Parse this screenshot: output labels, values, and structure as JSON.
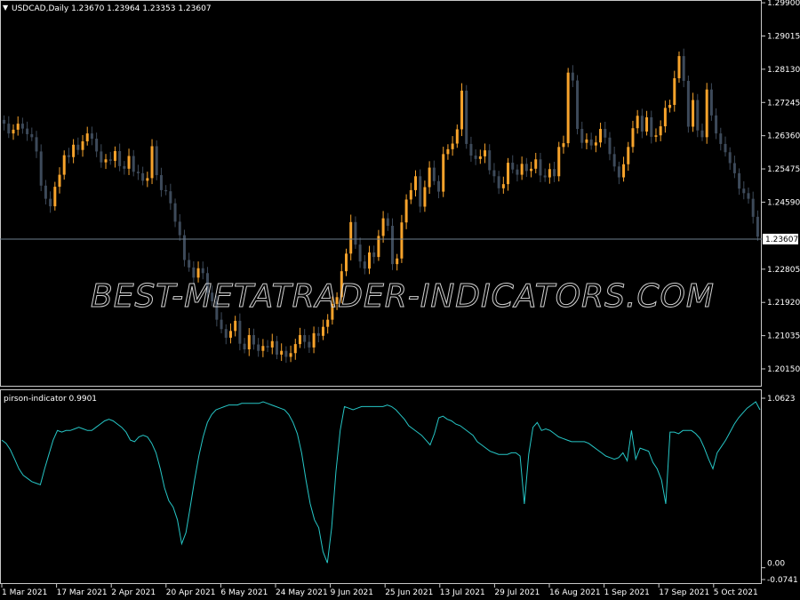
{
  "main_panel": {
    "header": "USDCAD,Daily  1.23670 1.23964 1.23353 1.23607",
    "current_price_label": "1.23607",
    "watermark": "BEST-METATRADER-INDICATORS.COM"
  },
  "indicator_panel": {
    "header": "pirson-indicator 0.9901",
    "ytick_labels": [
      "1.0623",
      "0.00",
      "-0.0741"
    ]
  },
  "colors": {
    "background": "#000000",
    "bull_candle": "#f7a32b",
    "bear_candle": "#3d4a5a",
    "indicator_line": "#26c6c6",
    "grid_line": "#ffffff",
    "price_line": "#6e7f8f"
  },
  "chart_data": [
    {
      "type": "candlestick",
      "title": "USDCAD,Daily",
      "ylim": [
        1.197,
        1.2995
      ],
      "y_ticks": [
        "1.29900",
        "1.29015",
        "1.28130",
        "1.27245",
        "1.26360",
        "1.25475",
        "1.24590",
        "1.23607",
        "1.22805",
        "1.21920",
        "1.21035",
        "1.20150"
      ],
      "x_tick_labels": [
        "1 Mar 2021",
        "17 Mar 2021",
        "2 Apr 2021",
        "20 Apr 2021",
        "6 May 2021",
        "24 May 2021",
        "9 Jun 2021",
        "25 Jun 2021",
        "13 Jul 2021",
        "29 Jul 2021",
        "16 Aug 2021",
        "1 Sep 2021",
        "17 Sep 2021",
        "5 Oct 2021"
      ],
      "last_ohlc": {
        "open": 1.2367,
        "high": 1.23964,
        "low": 1.23353,
        "close": 1.23607
      },
      "close": [
        1.2668,
        1.2642,
        1.2652,
        1.2668,
        1.2655,
        1.264,
        1.2632,
        1.2594,
        1.2503,
        1.2468,
        1.2448,
        1.25,
        1.2532,
        1.2584,
        1.2579,
        1.2612,
        1.2598,
        1.2621,
        1.2642,
        1.2628,
        1.2594,
        1.2565,
        1.2573,
        1.2569,
        1.2595,
        1.2555,
        1.2548,
        1.2582,
        1.254,
        1.2536,
        1.2516,
        1.2523,
        1.2608,
        1.2531,
        1.2491,
        1.2488,
        1.2456,
        1.2407,
        1.2371,
        1.2305,
        1.2285,
        1.2258,
        1.2283,
        1.227,
        1.2218,
        1.2195,
        1.2146,
        1.2121,
        1.2098,
        1.2116,
        1.2143,
        1.2082,
        1.2067,
        1.2105,
        1.208,
        1.2063,
        1.2076,
        1.2072,
        1.2089,
        1.2053,
        1.2063,
        1.2047,
        1.2057,
        1.2081,
        1.2105,
        1.2087,
        1.2072,
        1.211,
        1.2103,
        1.2127,
        1.2146,
        1.2188,
        1.2206,
        1.2275,
        1.2322,
        1.2406,
        1.2346,
        1.2301,
        1.2282,
        1.2325,
        1.2313,
        1.2369,
        1.2416,
        1.2396,
        1.2294,
        1.2309,
        1.2405,
        1.2466,
        1.2491,
        1.2528,
        1.2447,
        1.2499,
        1.2551,
        1.2515,
        1.2487,
        1.2587,
        1.26,
        1.2615,
        1.2653,
        1.2756,
        1.2614,
        1.2583,
        1.2574,
        1.2581,
        1.2597,
        1.2544,
        1.2528,
        1.2496,
        1.2507,
        1.2564,
        1.2546,
        1.2532,
        1.2561,
        1.2542,
        1.2548,
        1.2573,
        1.253,
        1.2525,
        1.2547,
        1.2528,
        1.2606,
        1.2616,
        1.2804,
        1.2783,
        1.2654,
        1.2617,
        1.2626,
        1.261,
        1.2618,
        1.2654,
        1.2631,
        1.2587,
        1.2554,
        1.2525,
        1.256,
        1.2606,
        1.2656,
        1.2689,
        1.2647,
        1.2685,
        1.2633,
        1.2637,
        1.2661,
        1.271,
        1.2718,
        1.2789,
        1.2848,
        1.2782,
        1.266,
        1.2731,
        1.265,
        1.2632,
        1.2759,
        1.269,
        1.2642,
        1.2614,
        1.2592,
        1.2563,
        1.2536,
        1.2495,
        1.2483,
        1.2468,
        1.242,
        1.2367
      ],
      "series_text": "OHLC candles; orange = up, grey = down"
    },
    {
      "type": "line",
      "title": "pirson-indicator",
      "current_value": 0.9901,
      "ylim": [
        -0.0741,
        1.0623
      ],
      "y_ticks": [
        1.0623,
        0.0,
        -0.0741
      ],
      "values": [
        0.8,
        0.78,
        0.74,
        0.68,
        0.62,
        0.58,
        0.56,
        0.54,
        0.53,
        0.52,
        0.62,
        0.71,
        0.8,
        0.86,
        0.85,
        0.86,
        0.86,
        0.87,
        0.88,
        0.87,
        0.86,
        0.86,
        0.88,
        0.9,
        0.92,
        0.93,
        0.92,
        0.9,
        0.88,
        0.85,
        0.8,
        0.79,
        0.82,
        0.83,
        0.82,
        0.78,
        0.72,
        0.62,
        0.5,
        0.42,
        0.38,
        0.3,
        0.15,
        0.22,
        0.38,
        0.55,
        0.7,
        0.82,
        0.91,
        0.96,
        0.99,
        1.0,
        1.01,
        1.02,
        1.02,
        1.02,
        1.03,
        1.03,
        1.03,
        1.03,
        1.03,
        1.04,
        1.03,
        1.02,
        1.01,
        1.0,
        0.99,
        0.96,
        0.91,
        0.84,
        0.72,
        0.55,
        0.4,
        0.3,
        0.25,
        0.1,
        0.03,
        0.25,
        0.6,
        0.86,
        1.01,
        1.0,
        0.99,
        1.0,
        1.01,
        1.01,
        1.01,
        1.01,
        1.01,
        1.01,
        1.02,
        1.01,
        0.99,
        0.96,
        0.93,
        0.89,
        0.87,
        0.85,
        0.83,
        0.8,
        0.77,
        0.84,
        0.94,
        0.95,
        0.93,
        0.92,
        0.9,
        0.89,
        0.87,
        0.85,
        0.83,
        0.79,
        0.77,
        0.75,
        0.73,
        0.72,
        0.71,
        0.71,
        0.71,
        0.72,
        0.72,
        0.7,
        0.4,
        0.71,
        0.88,
        0.91,
        0.86,
        0.87,
        0.86,
        0.84,
        0.82,
        0.81,
        0.8,
        0.79,
        0.79,
        0.79,
        0.79,
        0.78,
        0.76,
        0.74,
        0.72,
        0.7,
        0.69,
        0.68,
        0.69,
        0.72,
        0.67,
        0.86,
        0.68,
        0.75,
        0.74,
        0.73,
        0.66,
        0.62,
        0.55,
        0.4,
        0.85,
        0.85,
        0.84,
        0.86,
        0.86,
        0.86,
        0.84,
        0.81,
        0.75,
        0.68,
        0.62,
        0.72,
        0.76,
        0.8,
        0.85,
        0.9,
        0.94,
        0.97,
        1.0,
        1.02,
        1.04,
        0.99
      ]
    }
  ]
}
